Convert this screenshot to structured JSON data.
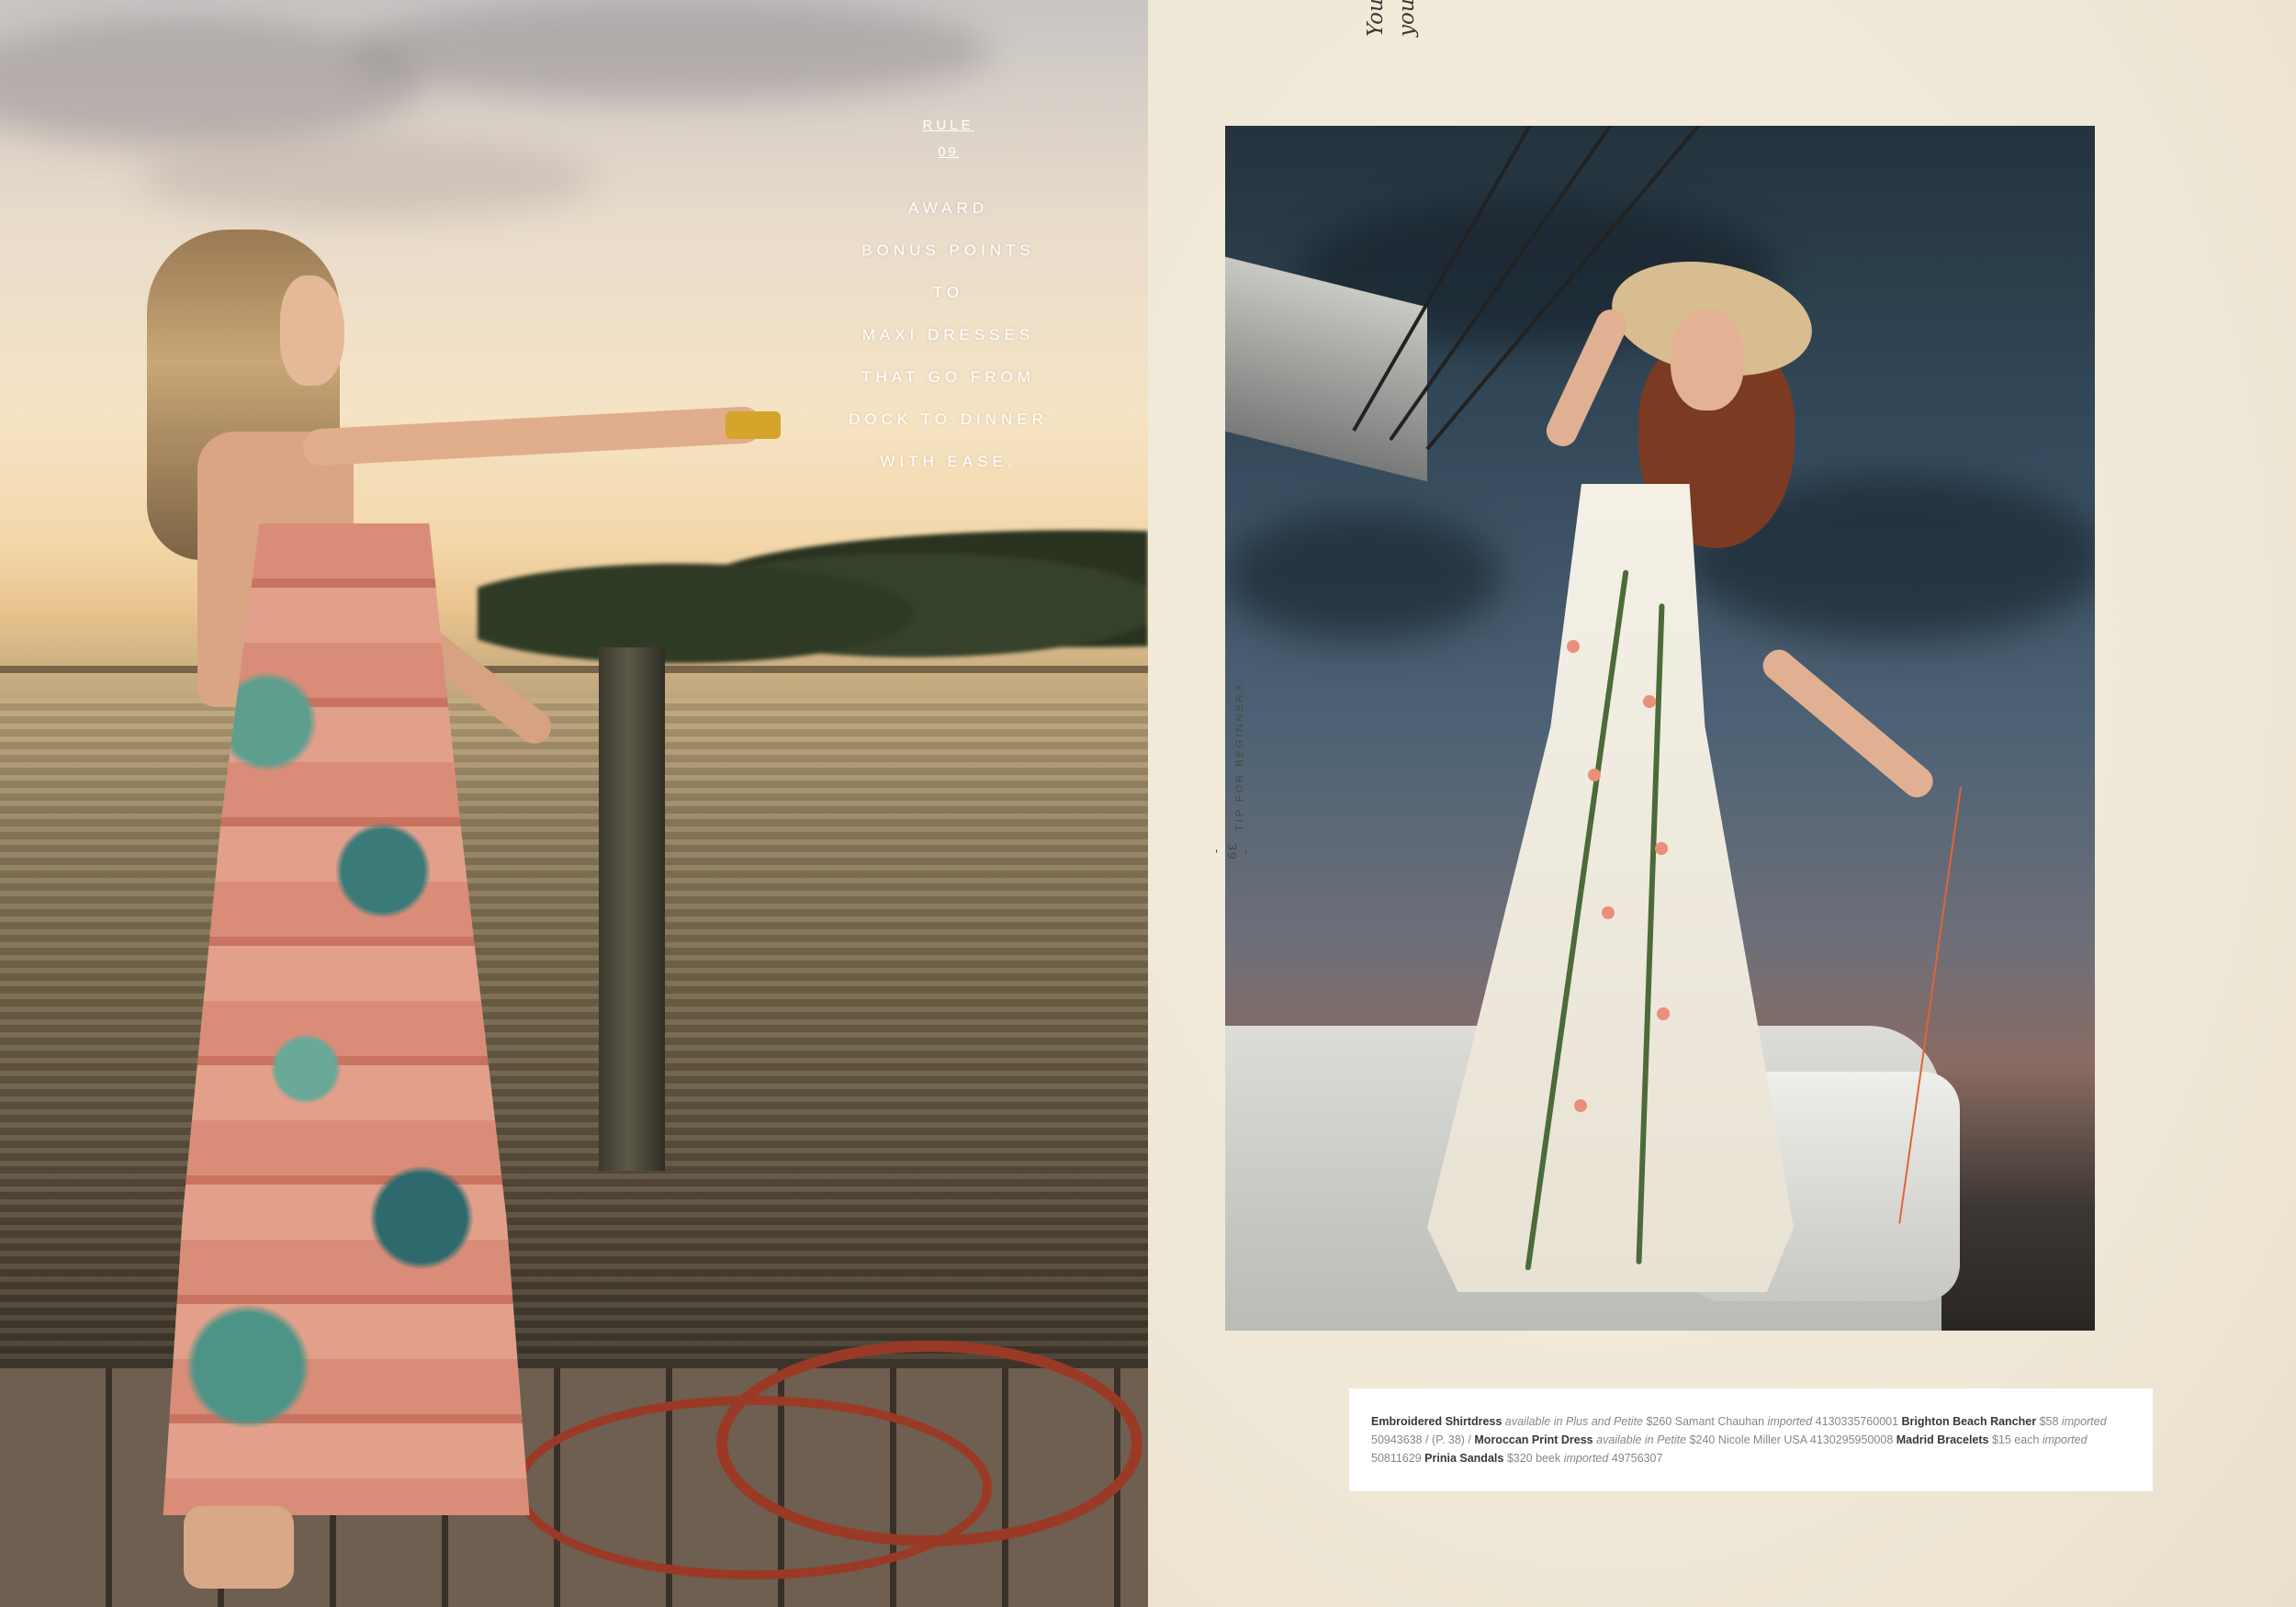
{
  "left_page": {
    "rule": {
      "label": "RULE",
      "number": "09",
      "lines": [
        "AWARD",
        "BONUS POINTS",
        "TO",
        "MAXI DRESSES",
        "THAT GO FROM",
        "DOCK TO DINNER",
        "WITH EASE."
      ]
    }
  },
  "right_page": {
    "caption": [
      {
        "name": "Embroidered Shirtdress",
        "note": "available in Plus and Petite",
        "detail": "$260 Samant Chauhan",
        "origin": "imported",
        "sku": "4130335760001"
      },
      {
        "name": "Brighton Beach Rancher",
        "detail": "$58",
        "origin": "imported",
        "sku": "50943638",
        "ref": "/ (P. 38) /"
      },
      {
        "name": "Moroccan Print Dress",
        "note": "available in Petite",
        "detail": "$240 Nicole Miller USA",
        "sku": "4130295950008"
      },
      {
        "name": "Madrid Bracelets",
        "detail": "$15 each",
        "origin": "imported",
        "sku": "50811629"
      },
      {
        "name": "Prinia Sandals",
        "detail": "$320 beek",
        "origin": "imported",
        "sku": "49756307"
      }
    ],
    "side_tip": "TIP FOR BEGINNERS:",
    "page_number": "- 39 -",
    "handwritten_note": [
      "Your cast will have a better snap with movement from",
      "your elbow rather than your shoulder."
    ]
  },
  "colors": {
    "page_background": "#f3ecdd",
    "caption_text": "#8b8680",
    "caption_bold": "#3b3733",
    "rule_text": "#ffffff"
  }
}
